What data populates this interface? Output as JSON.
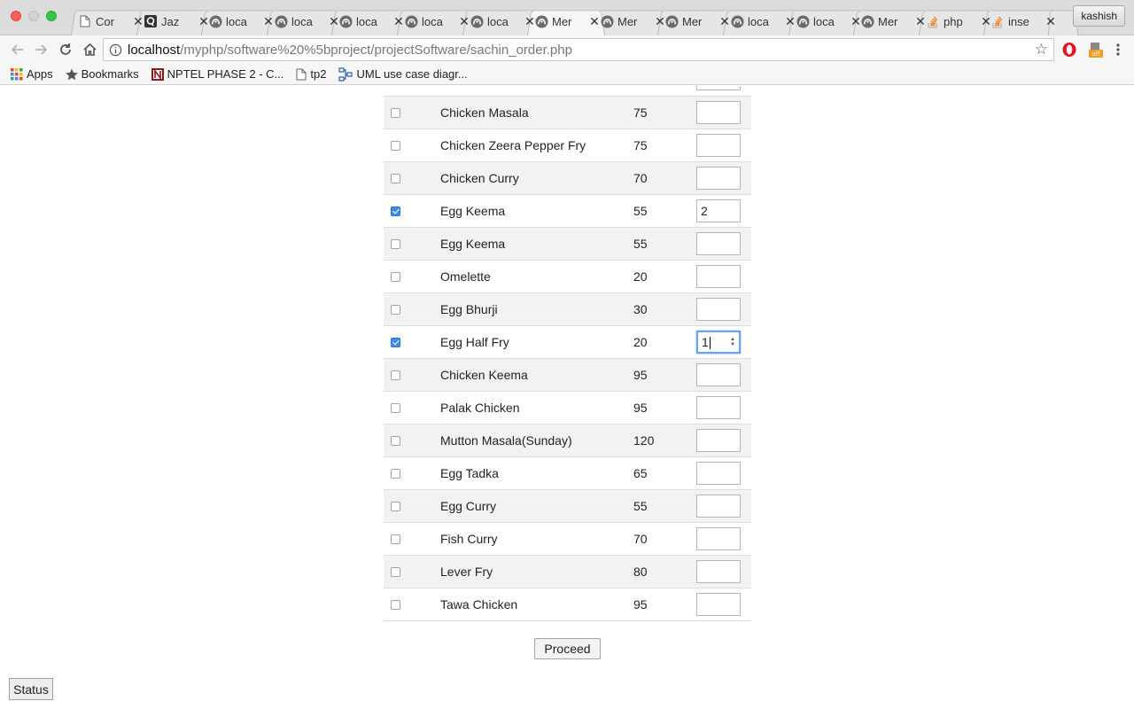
{
  "browser": {
    "tabs": [
      {
        "title": "Cor",
        "icon": "page-icon",
        "active": false
      },
      {
        "title": "Jaz",
        "icon": "quora-icon",
        "active": false
      },
      {
        "title": "loca",
        "icon": "phpmyadmin-icon",
        "active": false
      },
      {
        "title": "loca",
        "icon": "phpmyadmin-icon",
        "active": false
      },
      {
        "title": "loca",
        "icon": "phpmyadmin-icon",
        "active": false
      },
      {
        "title": "loca",
        "icon": "phpmyadmin-icon",
        "active": false
      },
      {
        "title": "loca",
        "icon": "phpmyadmin-icon",
        "active": false
      },
      {
        "title": "Mer",
        "icon": "phpmyadmin-icon",
        "active": true
      },
      {
        "title": "Mer",
        "icon": "phpmyadmin-icon",
        "active": false
      },
      {
        "title": "Mer",
        "icon": "phpmyadmin-icon",
        "active": false
      },
      {
        "title": "loca",
        "icon": "phpmyadmin-icon",
        "active": false
      },
      {
        "title": "loca",
        "icon": "phpmyadmin-icon",
        "active": false
      },
      {
        "title": "Mer",
        "icon": "phpmyadmin-icon",
        "active": false
      },
      {
        "title": "php",
        "icon": "stackoverflow-icon",
        "active": false
      },
      {
        "title": "inse",
        "icon": "stackoverflow-icon",
        "active": false
      }
    ],
    "profile_name": "kashish",
    "url_host": "localhost",
    "url_path": "/myphp/software%20%5bproject/projectSoftware/sachin_order.php",
    "bookmarks": [
      {
        "label": "Apps",
        "icon": "apps-grid-icon"
      },
      {
        "label": "Bookmarks",
        "icon": "star-icon"
      },
      {
        "label": "NPTEL PHASE 2 - C...",
        "icon": "nptel-icon"
      },
      {
        "label": "tp2",
        "icon": "page-icon"
      },
      {
        "label": "UML use case diagr...",
        "icon": "diagram-icon"
      }
    ],
    "extension_badge": "off"
  },
  "menu": {
    "items": [
      {
        "name": "Chicken Masala",
        "price": "75",
        "checked": false,
        "qty": ""
      },
      {
        "name": "Chicken Zeera Pepper Fry",
        "price": "75",
        "checked": false,
        "qty": ""
      },
      {
        "name": "Chicken Curry",
        "price": "70",
        "checked": false,
        "qty": ""
      },
      {
        "name": "Egg Keema",
        "price": "55",
        "checked": true,
        "qty": "2"
      },
      {
        "name": "Egg Keema",
        "price": "55",
        "checked": false,
        "qty": ""
      },
      {
        "name": "Omelette",
        "price": "20",
        "checked": false,
        "qty": ""
      },
      {
        "name": "Egg Bhurji",
        "price": "30",
        "checked": false,
        "qty": ""
      },
      {
        "name": "Egg Half Fry",
        "price": "20",
        "checked": true,
        "qty": "1",
        "focused": true
      },
      {
        "name": "Chicken Keema",
        "price": "95",
        "checked": false,
        "qty": ""
      },
      {
        "name": "Palak Chicken",
        "price": "95",
        "checked": false,
        "qty": ""
      },
      {
        "name": "Mutton Masala(Sunday)",
        "price": "120",
        "checked": false,
        "qty": ""
      },
      {
        "name": "Egg Tadka",
        "price": "65",
        "checked": false,
        "qty": ""
      },
      {
        "name": "Egg Curry",
        "price": "55",
        "checked": false,
        "qty": ""
      },
      {
        "name": "Fish Curry",
        "price": "70",
        "checked": false,
        "qty": ""
      },
      {
        "name": "Lever Fry",
        "price": "80",
        "checked": false,
        "qty": ""
      },
      {
        "name": "Tawa Chicken",
        "price": "95",
        "checked": false,
        "qty": ""
      }
    ],
    "proceed_label": "Proceed",
    "status_label": "Status"
  }
}
